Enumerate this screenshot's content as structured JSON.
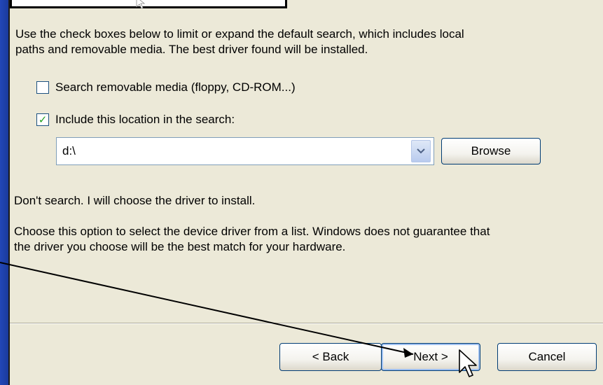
{
  "description": {
    "line1": "Use the check boxes below to limit or expand the default search, which includes local",
    "line2": "paths and removable media. The best driver found will be installed."
  },
  "options": {
    "removable": {
      "label": "Search removable media (floppy, CD-ROM...)",
      "checked": false
    },
    "include_location": {
      "label": "Include this location in the search:",
      "checked": true
    }
  },
  "location": {
    "value": "d:\\"
  },
  "browse_label": "Browse",
  "dont_search_label": "Don't search. I will choose the driver to install.",
  "choose_info": {
    "line1": "Choose this option to select the device driver from a list.  Windows does not guarantee that",
    "line2": "the driver you choose will be the best match for your hardware."
  },
  "buttons": {
    "back": "< Back",
    "next": "Next >",
    "cancel": "Cancel"
  },
  "colors": {
    "desktop": "#1c3fa8",
    "dialog": "#ece9d8",
    "check": "#21a121",
    "button_border": "#003c74"
  },
  "icons": [
    "checkmark-icon",
    "dropdown-arrow-icon",
    "mouse-pointer-icon"
  ]
}
